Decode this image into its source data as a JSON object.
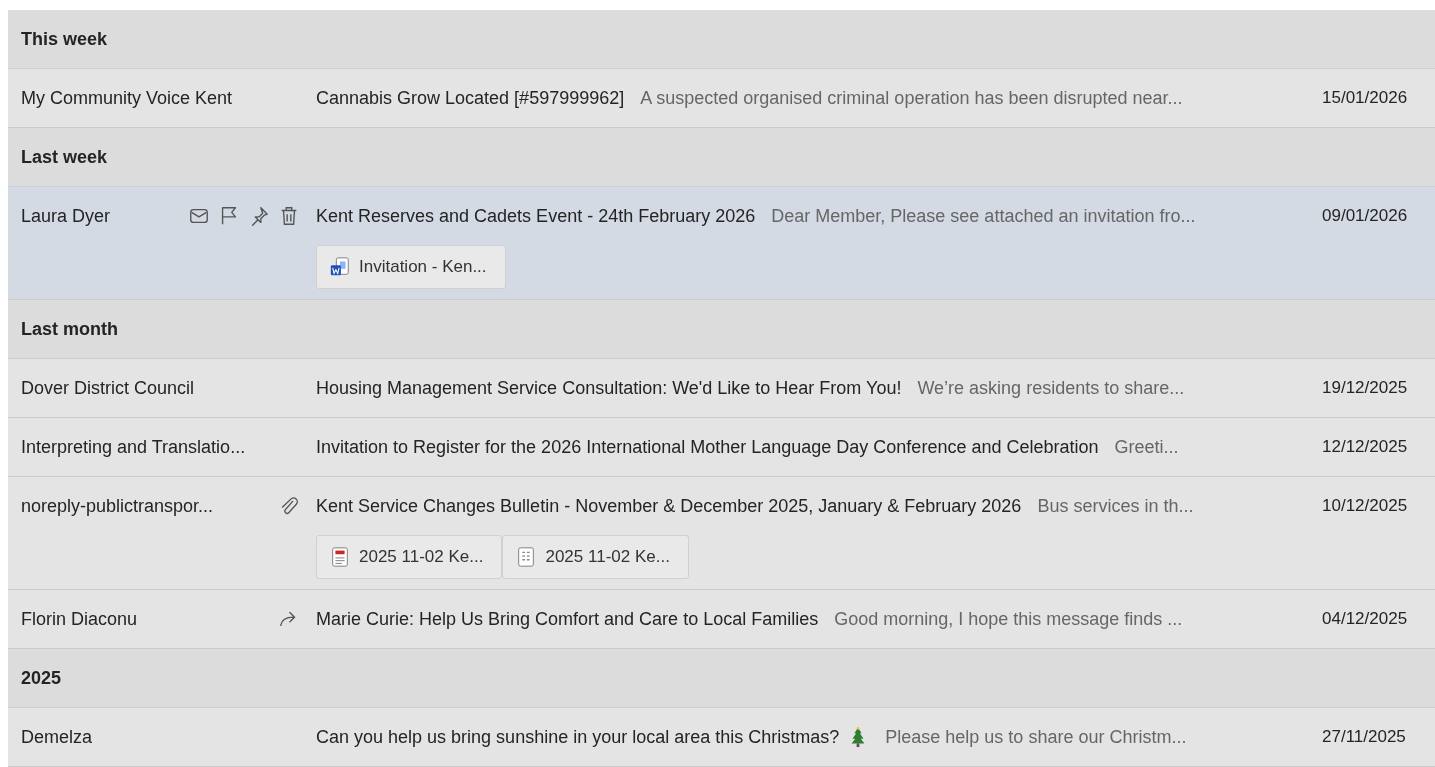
{
  "groups": [
    {
      "title": "This week",
      "messages": [
        {
          "sender": "My Community Voice Kent",
          "subject": "Cannabis Grow Located [#597999962]",
          "preview": "A suspected organised criminal operation has been disrupted near...",
          "date": "15/01/2026",
          "selected": false
        }
      ]
    },
    {
      "title": "Last week",
      "messages": [
        {
          "sender": "Laura Dyer",
          "subject": "Kent Reserves and Cadets Event - 24th February 2026",
          "preview": "Dear Member, Please see attached an invitation fro...",
          "date": "09/01/2026",
          "selected": true,
          "hover_actions": true,
          "attachments": [
            {
              "kind": "word",
              "name": "Invitation - Ken..."
            }
          ]
        }
      ]
    },
    {
      "title": "Last month",
      "messages": [
        {
          "sender": "Dover District Council",
          "subject": "Housing Management Service Consultation: We'd Like to Hear From You!",
          "preview": "We’re asking residents to share...",
          "date": "19/12/2025",
          "selected": false
        },
        {
          "sender": "Interpreting and Translatio...",
          "subject": "Invitation to Register for the 2026 International Mother Language Day Conference and Celebration",
          "preview": "Greeti...",
          "date": "12/12/2025",
          "selected": false
        },
        {
          "sender": "noreply-publictranspor...",
          "subject": "Kent Service Changes Bulletin - November & December 2025, January & February 2026",
          "preview": "Bus services in th...",
          "date": "10/12/2025",
          "selected": false,
          "has_attachment": true,
          "attachments": [
            {
              "kind": "pdf",
              "name": "2025 11-02 Ke..."
            },
            {
              "kind": "sheet",
              "name": "2025 11-02 Ke..."
            }
          ]
        },
        {
          "sender": "Florin Diaconu",
          "subject": "Marie Curie: Help Us Bring Comfort and Care to Local Families",
          "preview": "Good morning, I hope this message finds ...",
          "date": "04/12/2025",
          "selected": false,
          "forwarded": true
        }
      ]
    },
    {
      "title": "2025",
      "messages": [
        {
          "sender": "Demelza",
          "subject": "Can you help us bring sunshine in your local area this Christmas?",
          "tree_emoji": true,
          "preview": "Please help us to share our Christm...",
          "date": "27/11/2025",
          "selected": false
        }
      ]
    }
  ]
}
